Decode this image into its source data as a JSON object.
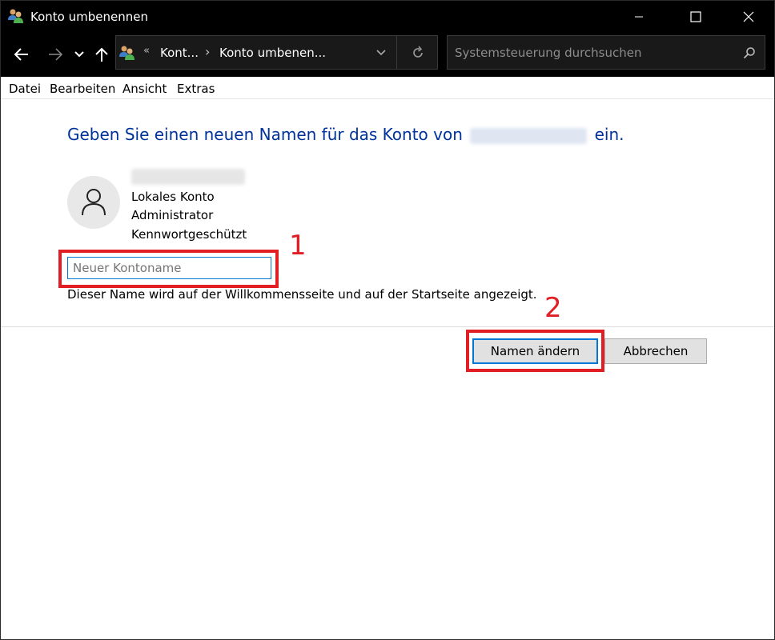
{
  "window": {
    "title": "Konto umbenennen",
    "minimize_icon": "minimize-icon",
    "maximize_icon": "maximize-icon",
    "close_icon": "close-icon"
  },
  "addressbar": {
    "breadcrumb_separator_start": "«",
    "breadcrumb_1": "Kont...",
    "breadcrumb_arrow": "›",
    "breadcrumb_2": "Konto umbenen...",
    "search_placeholder": "Systemsteuerung durchsuchen"
  },
  "menu": {
    "items": [
      "Datei",
      "Bearbeiten",
      "Ansicht",
      "Extras"
    ]
  },
  "main": {
    "heading_before": "Geben Sie einen neuen Namen für das Konto von",
    "heading_after": "ein.",
    "account_type": "Lokales Konto",
    "account_role": "Administrator",
    "account_protection": "Kennwortgeschützt",
    "input_placeholder": "Neuer Kontoname",
    "hint": "Dieser Name wird auf der Willkommensseite und auf der Startseite angezeigt."
  },
  "buttons": {
    "rename": "Namen ändern",
    "cancel": "Abbrechen"
  },
  "annotations": {
    "step1": "1",
    "step2": "2",
    "color": "#e01e24"
  },
  "colors": {
    "heading": "#003399",
    "focus": "#0078d7"
  }
}
